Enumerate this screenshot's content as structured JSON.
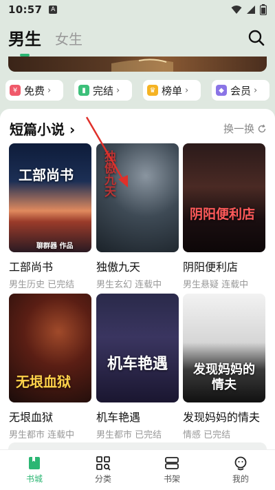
{
  "status": {
    "time": "10:57",
    "notification_glyph": "A"
  },
  "header": {
    "tab_active": "男生",
    "tab_inactive": "女生"
  },
  "chips": [
    {
      "label": "免费",
      "icon": "coin-icon",
      "color": "#f0596a"
    },
    {
      "label": "完结",
      "icon": "book-done-icon",
      "color": "#3cc07a"
    },
    {
      "label": "榜单",
      "icon": "crown-icon",
      "color": "#f5b323"
    },
    {
      "label": "会员",
      "icon": "vip-icon",
      "color": "#8a74e6"
    }
  ],
  "section": {
    "title": "短篇小说",
    "refresh_label": "换一换"
  },
  "books": [
    {
      "title": "工部尚书",
      "meta": "男生历史 已完结",
      "cover_title": "工部尚书",
      "cover_sub": "聊群器 作品"
    },
    {
      "title": "独傲九天",
      "meta": "男生玄幻 连载中",
      "cover_title": "独傲九天"
    },
    {
      "title": "阴阳便利店",
      "meta": "男生悬疑 连载中",
      "cover_title": "阴阳便利店"
    },
    {
      "title": "无垠血狱",
      "meta": "男生都市 连载中",
      "cover_title": "无垠血狱"
    },
    {
      "title": "机车艳遇",
      "meta": "男生都市 已完结",
      "cover_title": "机车艳遇"
    },
    {
      "title": "发现妈妈的情夫",
      "meta": "情感 已完结",
      "cover_title": "发现妈妈的情夫"
    }
  ],
  "nav": [
    {
      "label": "书城",
      "icon": "bookstore-icon",
      "active": true
    },
    {
      "label": "分类",
      "icon": "category-icon",
      "active": false
    },
    {
      "label": "书架",
      "icon": "bookshelf-icon",
      "active": false
    },
    {
      "label": "我的",
      "icon": "profile-icon",
      "active": false
    }
  ],
  "colors": {
    "accent": "#2bb673",
    "background": "#dfe8e0"
  }
}
